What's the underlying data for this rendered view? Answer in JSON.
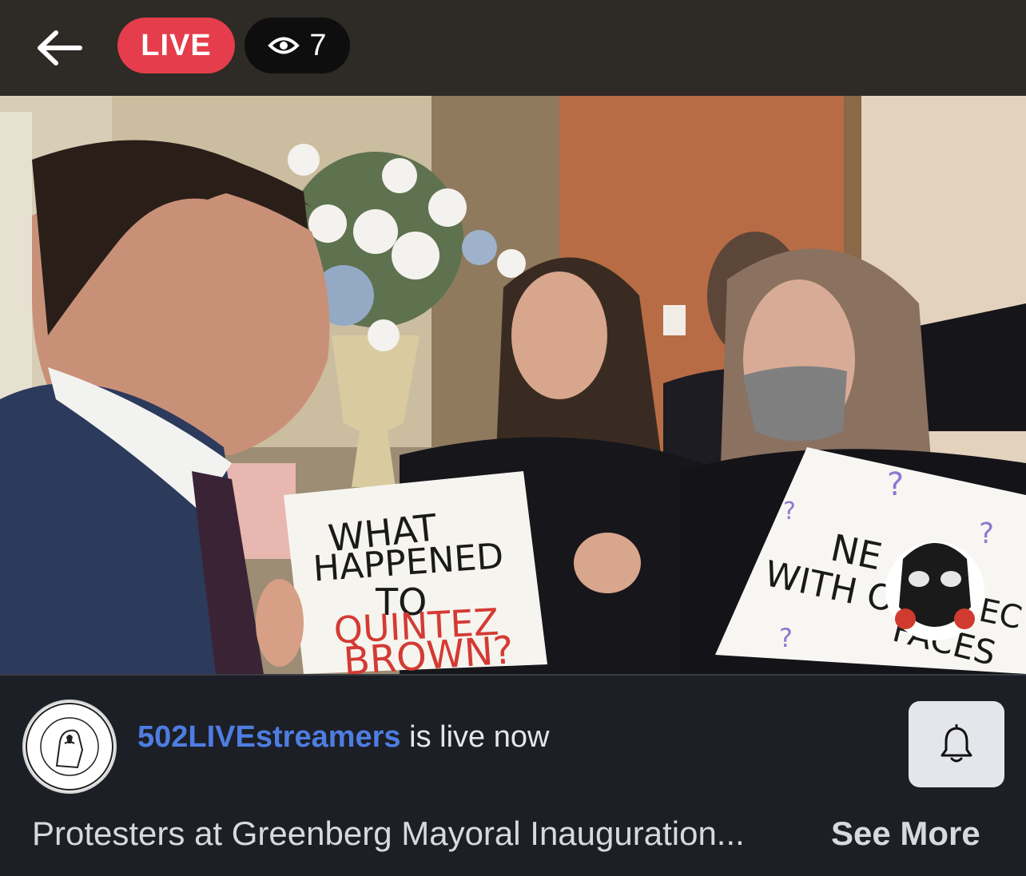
{
  "header": {
    "live_label": "LIVE",
    "viewer_count": "7"
  },
  "video": {
    "sign_left": [
      "WHAT",
      "HAPPENED",
      "TO",
      "QUINTEZ",
      "BROWN?"
    ],
    "sign_right": [
      "NE",
      "WITH OL",
      "EC",
      "FACES"
    ]
  },
  "footer": {
    "channel_name": "502LIVEstreamers",
    "status_text": " is live now",
    "description": "Protesters at Greenberg Mayoral Inauguration...",
    "see_more_label": "See More"
  },
  "colors": {
    "live_red": "#e53d4c",
    "channel_blue": "#4e7de2",
    "topbar": "#2e2a25",
    "panel": "#1c1f26"
  }
}
